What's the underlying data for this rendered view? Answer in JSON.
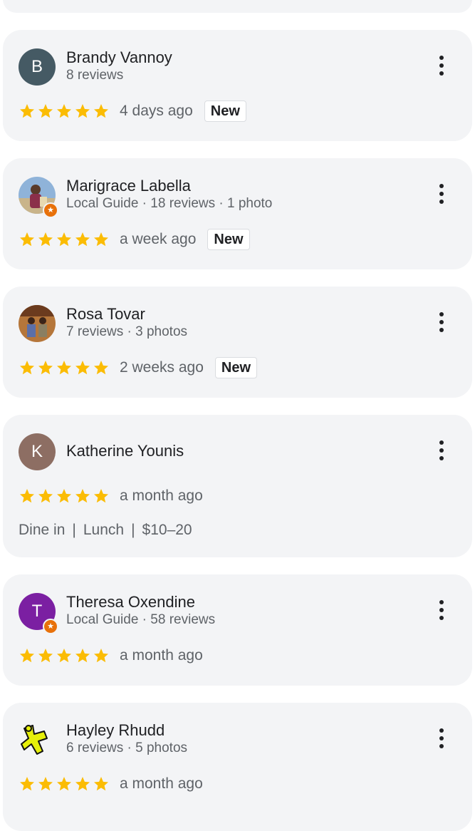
{
  "colors": {
    "star": "#fbbc04",
    "guide_badge": "#e8710a",
    "card_bg": "#f3f4f6"
  },
  "reviews": [
    {
      "name": "Brandy Vannoy",
      "initial": "B",
      "avatar_color": "#455a64",
      "subtitle": "8 reviews",
      "rating": 5,
      "time": "4 days ago",
      "badge": "New"
    },
    {
      "name": "Marigrace Labella",
      "avatar": "photo",
      "local_guide": true,
      "subtitle": "Local Guide · 18 reviews · 1 photo",
      "rating": 5,
      "time": "a week ago",
      "badge": "New"
    },
    {
      "name": "Rosa Tovar",
      "avatar": "photo",
      "subtitle": "7 reviews · 3 photos",
      "rating": 5,
      "time": "2 weeks ago",
      "badge": "New"
    },
    {
      "name": "Katherine Younis",
      "initial": "K",
      "avatar_color": "#8d6e63",
      "rating": 5,
      "time": "a month ago",
      "meta": [
        "Dine in",
        "Lunch",
        "$10–20"
      ]
    },
    {
      "name": "Theresa Oxendine",
      "initial": "T",
      "avatar_color": "#7b1fa2",
      "local_guide": true,
      "subtitle": "Local Guide · 58 reviews",
      "rating": 5,
      "time": "a month ago"
    },
    {
      "name": "Hayley Rhudd",
      "avatar": "photo",
      "subtitle": "6 reviews · 5 photos",
      "rating": 5,
      "time": "a month ago"
    }
  ],
  "more_icon": "more-vertical-icon",
  "star_icon": "star-icon"
}
